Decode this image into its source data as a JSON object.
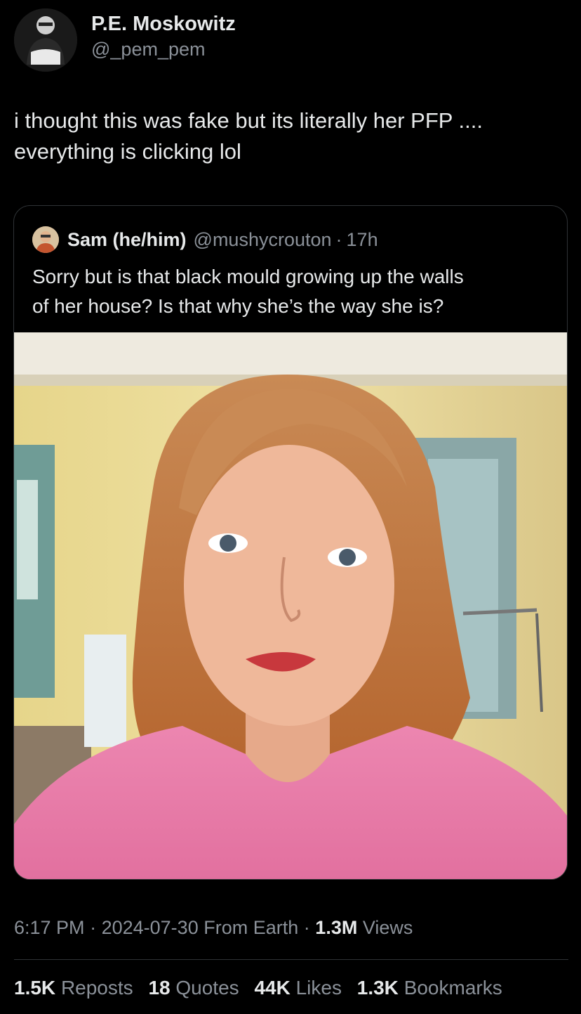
{
  "author": {
    "display_name": "P.E. Moskowitz",
    "handle": "@_pem_pem",
    "avatar_icon": "user-avatar-photo"
  },
  "tweet": {
    "text_line1": "i thought this was fake but its literally her PFP ....",
    "text_line2": "everything is clicking lol"
  },
  "quoted_tweet": {
    "display_name": "Sam (he/him)",
    "handle": "@mushycrouton",
    "separator": "·",
    "time": "17h",
    "text_line1": "Sorry but is that black mould growing up the walls",
    "text_line2": "of her house? Is that why she’s the way she is?",
    "avatar_icon": "user-avatar-photo",
    "media_icon": "portrait-photo"
  },
  "meta": {
    "time": "6:17 PM",
    "sep1": "·",
    "date": "2024-07-30",
    "source": "From Earth",
    "sep2": "·",
    "views_count": "1.3M",
    "views_label": "Views"
  },
  "stats": {
    "reposts_count": "1.5K",
    "reposts_label": "Reposts",
    "quotes_count": "18",
    "quotes_label": "Quotes",
    "likes_count": "44K",
    "likes_label": "Likes",
    "bookmarks_count": "1.3K",
    "bookmarks_label": "Bookmarks"
  },
  "colors": {
    "background": "#000000",
    "primary_text": "#e7e9ea",
    "secondary_text": "#8b9199",
    "border": "#2f3336"
  }
}
